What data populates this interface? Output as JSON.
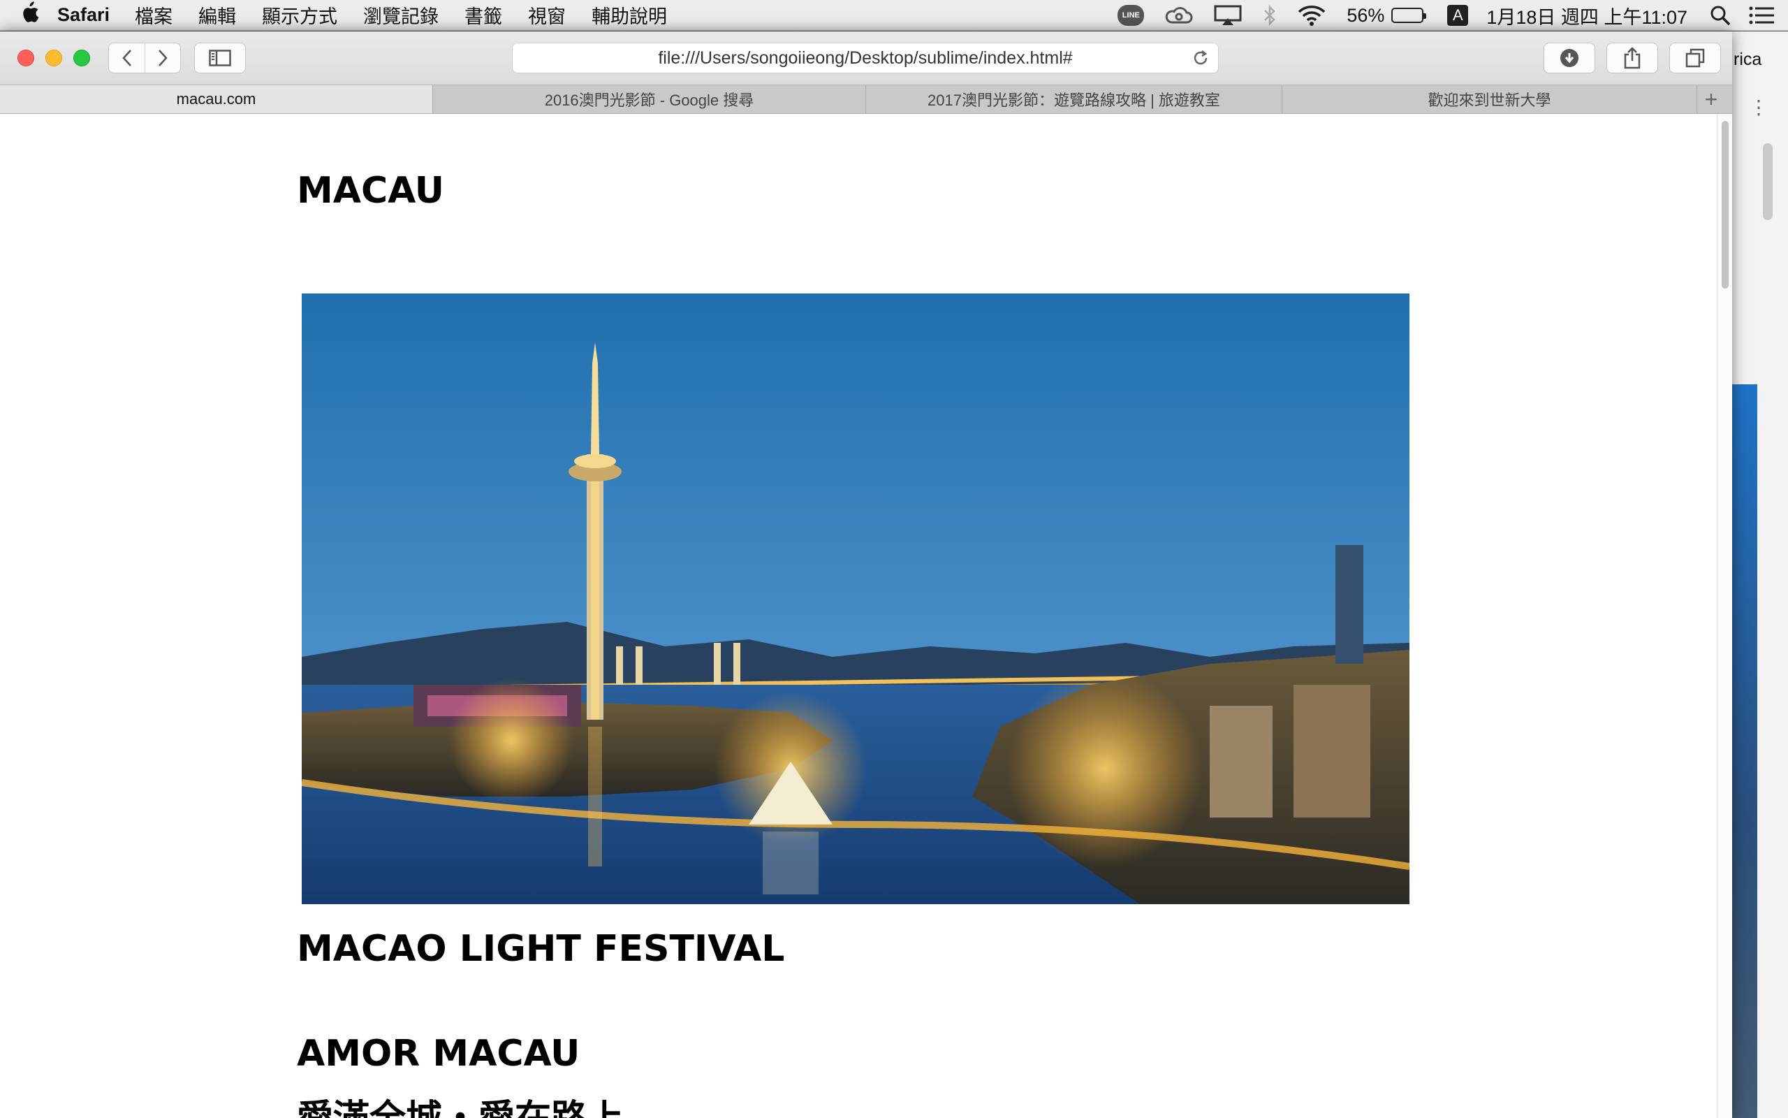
{
  "menubar": {
    "app_name": "Safari",
    "menus": [
      "檔案",
      "編輯",
      "顯示方式",
      "瀏覽記錄",
      "書籤",
      "視窗",
      "輔助說明"
    ],
    "line_badge": "LINE",
    "battery_percent": "56%",
    "battery_level": 0.56,
    "input_source": "A",
    "clock": "1月18日 週四 上午11:07"
  },
  "browser": {
    "url": "file:///Users/songoiieong/Desktop/sublime/index.html#",
    "tabs": [
      {
        "label": "macau.com",
        "active": true
      },
      {
        "label": "2016澳門光影節 - Google 搜尋",
        "active": false
      },
      {
        "label": "2017澳門光影節：遊覽路線攻略 | 旅遊教室",
        "active": false
      },
      {
        "label": "歡迎來到世新大學",
        "active": false
      }
    ],
    "new_tab_symbol": "+",
    "side_text": "rica"
  },
  "page": {
    "title": "MACAU",
    "section_1": "MACAO LIGHT FESTIVAL",
    "section_2": "AMOR MACAU",
    "section_2_subtitle": "愛滿全城・愛在路上"
  },
  "colors": {
    "sky_top": "#1f6fae",
    "sky_bottom": "#4a8fc7",
    "water": "#1e4a86",
    "lights": "#f5b43b",
    "mountains": "#27415f"
  }
}
